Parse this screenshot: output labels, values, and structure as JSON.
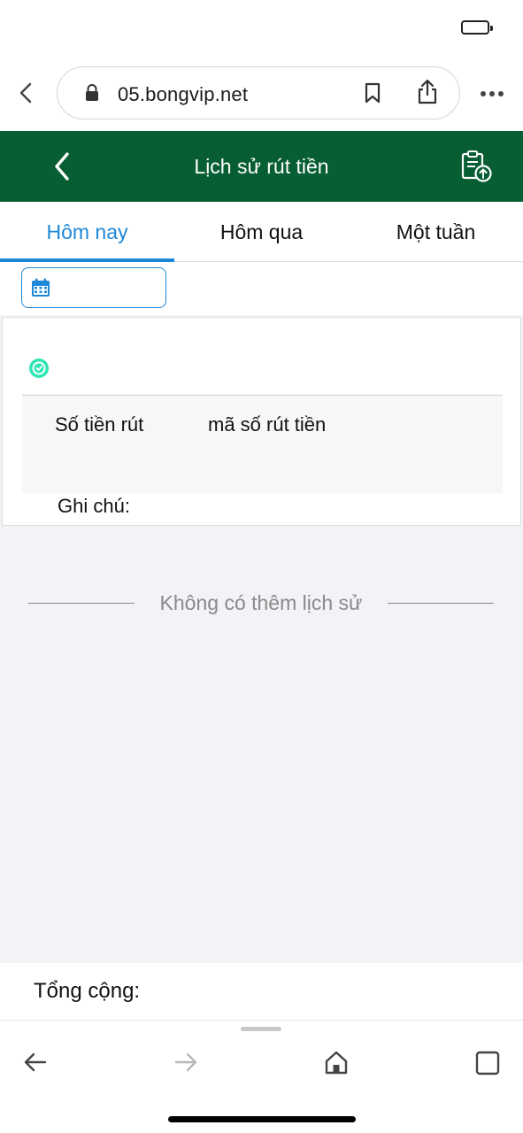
{
  "browser": {
    "url": "05.bongvip.net"
  },
  "header": {
    "title": "Lịch sử rút tiền"
  },
  "tabs": [
    {
      "label": "Hôm nay",
      "active": true
    },
    {
      "label": "Hôm qua",
      "active": false
    },
    {
      "label": "Một tuần",
      "active": false
    }
  ],
  "record": {
    "amount_label": "Số tiền rút",
    "code_label": "mã số rút tiền",
    "note_label": "Ghi chú:"
  },
  "history": {
    "empty_text": "Không có thêm lịch sử"
  },
  "summary": {
    "total_label": "Tổng cộng:"
  },
  "icons": {
    "header_back": "chevron-left-icon",
    "header_action": "clipboard-upload-icon",
    "calendar": "calendar-icon",
    "status": "clock-check-icon"
  },
  "colors": {
    "header_bg": "#075e32",
    "accent": "#1e88d8",
    "status_dot": "#2ee6b5"
  }
}
